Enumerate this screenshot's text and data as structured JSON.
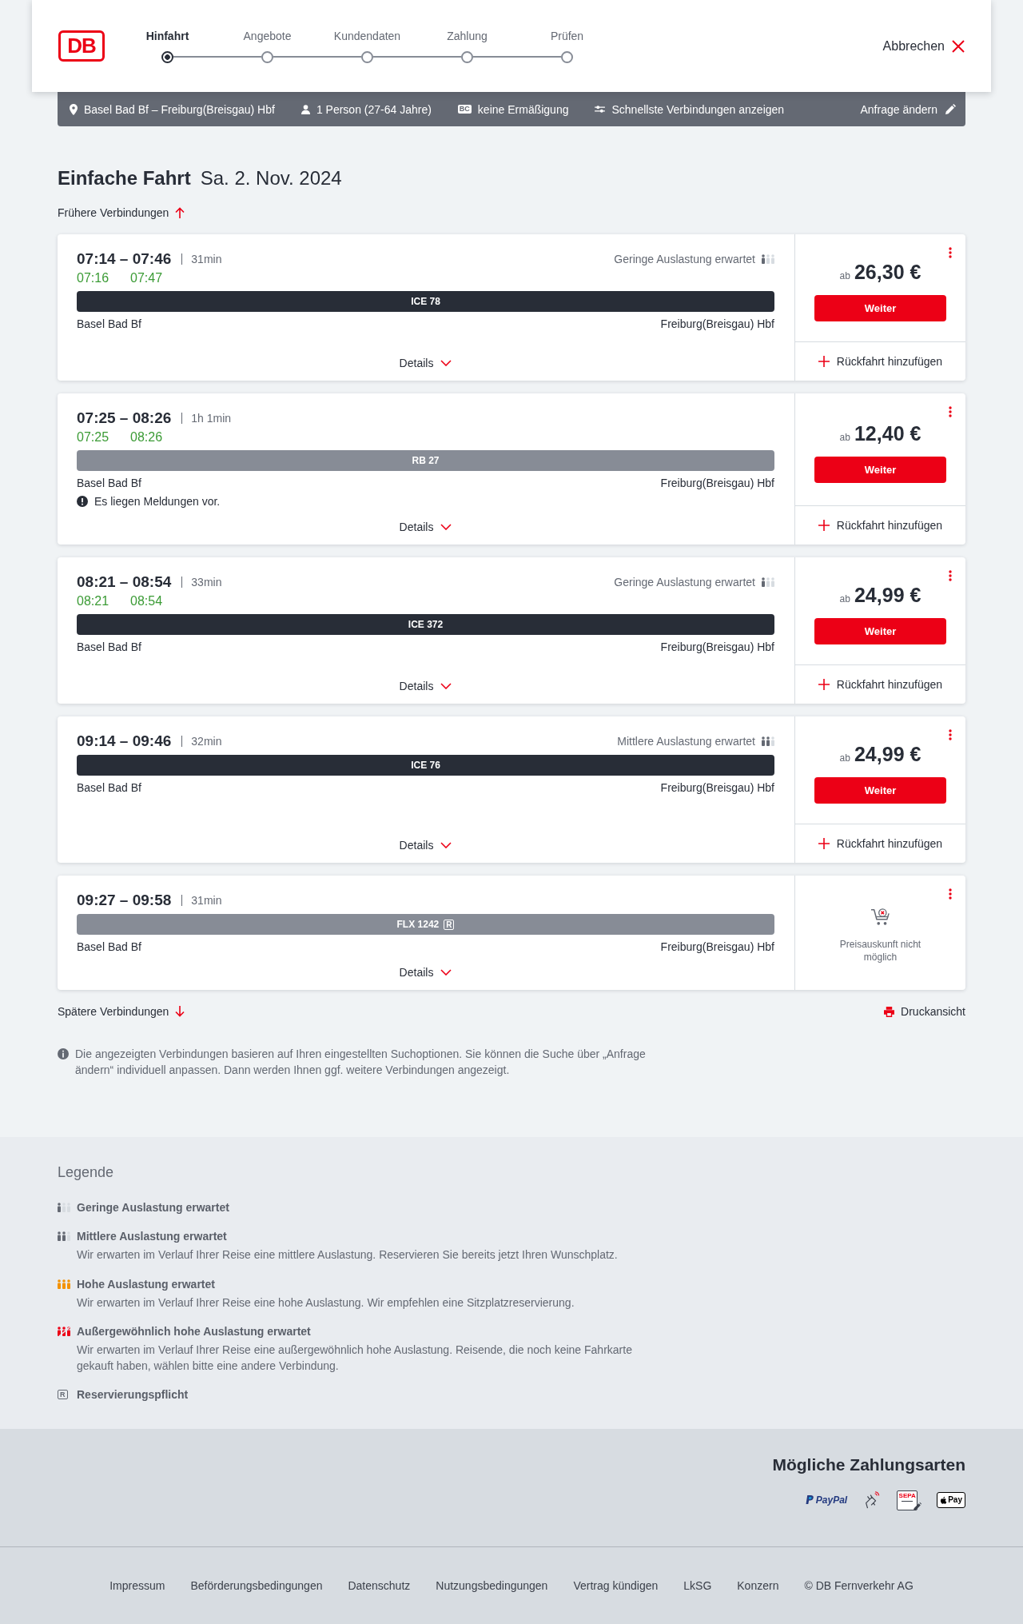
{
  "header": {
    "logo": "DB",
    "steps": [
      {
        "label": "Hinfahrt",
        "selected": true
      },
      {
        "label": "Angebote",
        "selected": false
      },
      {
        "label": "Kundendaten",
        "selected": false
      },
      {
        "label": "Zahlung",
        "selected": false
      },
      {
        "label": "Prüfen",
        "selected": false
      }
    ],
    "cancel": "Abbrechen"
  },
  "search_summary": {
    "route": "Basel Bad Bf – Freiburg(Breisgau) Hbf",
    "travelers": "1 Person (27-64 Jahre)",
    "discount_badge": "BC",
    "discount": "keine Ermäßigung",
    "option": "Schnellste Verbindungen anzeigen",
    "edit": "Anfrage ändern"
  },
  "heading": {
    "trip_type": "Einfache Fahrt",
    "date": "Sa. 2. Nov. 2024"
  },
  "earlier_link": "Frühere Verbindungen",
  "connections": [
    {
      "times": "07:14 – 07:46",
      "duration": "31min",
      "occupancy": {
        "kind": "low",
        "label": "Geringe Auslastung erwartet"
      },
      "realtime": [
        "07:16",
        "07:47"
      ],
      "train": {
        "kind": "ice",
        "name": "ICE 78"
      },
      "from": "Basel Bad Bf",
      "to": "Freiburg(Breisgau) Hbf",
      "details": "Details",
      "offer": {
        "kind": "price",
        "prefix": "ab",
        "price": "26,30 €",
        "button": "Weiter",
        "return": "Rückfahrt hinzufügen"
      }
    },
    {
      "times": "07:25 – 08:26",
      "duration": "1h 1min",
      "realtime": [
        "07:25",
        "08:26"
      ],
      "train": {
        "kind": "regional",
        "name": "RB 27"
      },
      "from": "Basel Bad Bf",
      "to": "Freiburg(Breisgau) Hbf",
      "notice": "Es liegen Meldungen vor.",
      "details": "Details",
      "offer": {
        "kind": "price",
        "prefix": "ab",
        "price": "12,40 €",
        "button": "Weiter",
        "return": "Rückfahrt hinzufügen"
      }
    },
    {
      "times": "08:21 – 08:54",
      "duration": "33min",
      "occupancy": {
        "kind": "low",
        "label": "Geringe Auslastung erwartet"
      },
      "realtime": [
        "08:21",
        "08:54"
      ],
      "train": {
        "kind": "ice",
        "name": "ICE 372"
      },
      "from": "Basel Bad Bf",
      "to": "Freiburg(Breisgau) Hbf",
      "details": "Details",
      "offer": {
        "kind": "price",
        "prefix": "ab",
        "price": "24,99 €",
        "button": "Weiter",
        "return": "Rückfahrt hinzufügen"
      }
    },
    {
      "times": "09:14 – 09:46",
      "duration": "32min",
      "occupancy": {
        "kind": "medium",
        "label": "Mittlere Auslastung erwartet"
      },
      "train": {
        "kind": "ice",
        "name": "ICE 76"
      },
      "from": "Basel Bad Bf",
      "to": "Freiburg(Breisgau) Hbf",
      "details": "Details",
      "offer": {
        "kind": "price",
        "prefix": "ab",
        "price": "24,99 €",
        "button": "Weiter",
        "return": "Rückfahrt hinzufügen"
      }
    },
    {
      "times": "09:27 – 09:58",
      "duration": "31min",
      "train": {
        "kind": "partner",
        "name": "FLX 1242",
        "badge": "R"
      },
      "from": "Basel Bad Bf",
      "to": "Freiburg(Breisgau) Hbf",
      "details": "Details",
      "offer": {
        "kind": "unavailable",
        "text": "Preisauskunft nicht möglich"
      }
    }
  ],
  "later_link": "Spätere Verbindungen",
  "print_link": "Druckansicht",
  "note": "Die angezeigten Verbindungen basieren auf Ihren eingestellten Suchoptionen. Sie können die Suche über „Anfrage ändern“ individuell anpassen. Dann werden Ihnen ggf. weitere Verbindungen angezeigt.",
  "legend": {
    "title": "Legende",
    "items": [
      {
        "kind": "low",
        "label": "Geringe Auslastung erwartet"
      },
      {
        "kind": "medium",
        "label": "Mittlere Auslastung erwartet",
        "description": "Wir erwarten im Verlauf Ihrer Reise eine mittlere Auslastung. Reservieren Sie bereits jetzt Ihren Wunschplatz."
      },
      {
        "kind": "high",
        "label": "Hohe Auslastung erwartet",
        "description": "Wir erwarten im Verlauf Ihrer Reise eine hohe Auslastung. Wir empfehlen eine Sitzplatzreservierung."
      },
      {
        "kind": "extreme",
        "label": "Außergewöhnlich hohe Auslastung erwartet",
        "description": "Wir erwarten im Verlauf Ihrer Reise eine außergewöhnlich hohe Auslastung. Reisende, die noch keine Fahrkarte gekauft haben, wählen bitte eine andere Verbindung."
      },
      {
        "kind": "reservation",
        "symbol": "R",
        "label": "Reservierungspflicht"
      }
    ]
  },
  "payment": {
    "title": "Mögliche Zahlungsarten",
    "methods": [
      {
        "kind": "paypal",
        "label": "PayPal"
      },
      {
        "kind": "contactless"
      },
      {
        "kind": "sepa",
        "label": "SEPA"
      },
      {
        "kind": "applepay",
        "label": "Pay"
      }
    ]
  },
  "footer": {
    "links": [
      "Impressum",
      "Beförderungsbedingungen",
      "Datenschutz",
      "Nutzungsbedingungen",
      "Vertrag kündigen",
      "LkSG",
      "Konzern"
    ],
    "copyright": "© DB Fernverkehr AG"
  }
}
